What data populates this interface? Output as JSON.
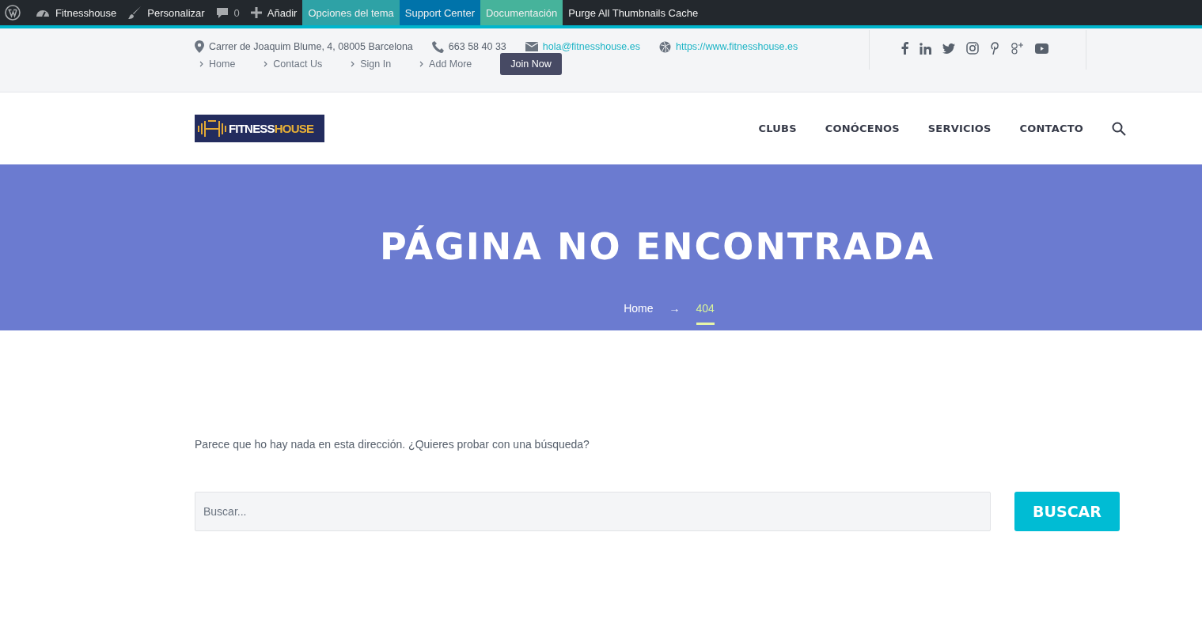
{
  "admin_bar": [
    {
      "kind": "wp"
    },
    {
      "kind": "dashboard",
      "label": "Fitnesshouse"
    },
    {
      "kind": "brush",
      "label": "Personalizar"
    },
    {
      "kind": "comments",
      "label": "0"
    },
    {
      "kind": "plus",
      "label": "Añadir"
    },
    {
      "kind": "text",
      "label": "Opciones del tema",
      "color": "#2ea2a6"
    },
    {
      "kind": "text",
      "label": "Support Center",
      "color": "#0073aa"
    },
    {
      "kind": "text",
      "label": "Documentación",
      "color": "#46b39b"
    },
    {
      "kind": "text",
      "label": "Purge All Thumbnails Cache"
    }
  ],
  "contact": [
    {
      "kind": "pin",
      "text": "Carrer de Joaquim Blume, 4, 08005 Barcelona",
      "link": false
    },
    {
      "kind": "phone",
      "text": "663 58 40 33",
      "link": false
    },
    {
      "kind": "mail",
      "text": "hola@fitnesshouse.es",
      "link": true
    },
    {
      "kind": "globe",
      "text": "https://www.fitnesshouse.es",
      "link": true
    }
  ],
  "social": [
    {
      "kind": "facebook"
    },
    {
      "kind": "linkedin"
    },
    {
      "kind": "twitter"
    },
    {
      "kind": "instagram"
    },
    {
      "kind": "pinterest"
    },
    {
      "kind": "googleplus"
    },
    {
      "kind": "youtube"
    }
  ],
  "top_links": [
    "Home",
    "Contact Us",
    "Sign In",
    "Add More"
  ],
  "join_button": "Join Now",
  "logo": {
    "part_1": "FITNESS",
    "part_2": "HOUSE"
  },
  "nav": [
    "CLUBS",
    "CONÓCENOS",
    "SERVICIOS",
    "CONTACTO"
  ],
  "hero": {
    "title": "PÁGINA NO ENCONTRADA",
    "breadcrumb": [
      {
        "label": "Home",
        "selected": false
      },
      {
        "label": "404",
        "selected": true
      }
    ],
    "separator": "→"
  },
  "message": "Parece que ho hay nada en esta dirección. ¿Quieres probar con una búsqueda?",
  "search": {
    "placeholder": "Buscar...",
    "button": "BUSCAR"
  }
}
